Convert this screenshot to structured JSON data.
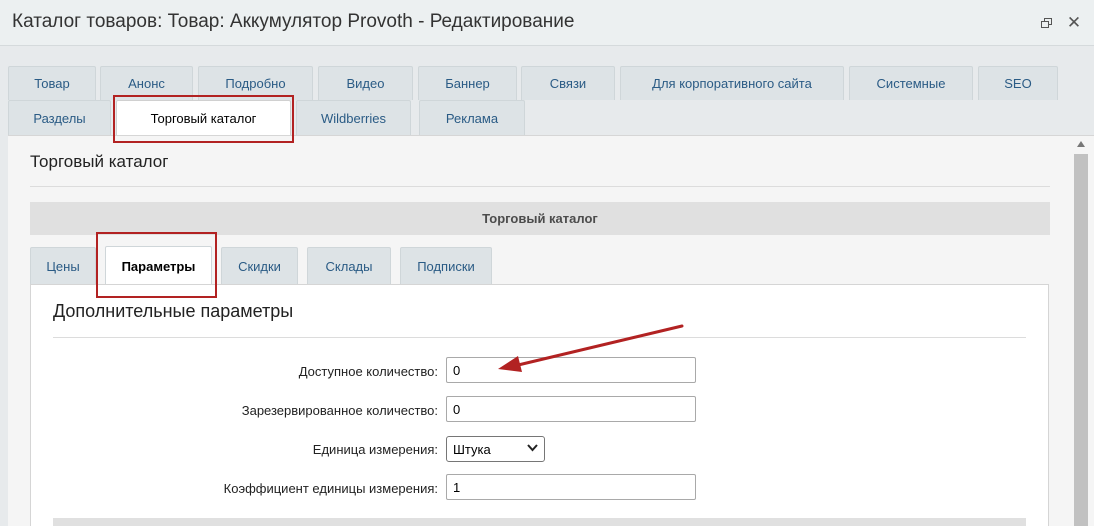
{
  "window": {
    "title": "Каталог товаров: Товар: Аккумулятор Provoth - Редактирование",
    "restore_icon": "restore-icon",
    "close_icon": "close-icon",
    "close_glyph": "✕"
  },
  "main_tabs": [
    {
      "label": "Товар"
    },
    {
      "label": "Анонс"
    },
    {
      "label": "Подробно"
    },
    {
      "label": "Видео"
    },
    {
      "label": "Баннер"
    },
    {
      "label": "Связи"
    },
    {
      "label": "Для корпоративного сайта"
    },
    {
      "label": "Системные"
    },
    {
      "label": "SEO"
    },
    {
      "label": "Разделы"
    },
    {
      "label": "Торговый каталог",
      "active": true
    },
    {
      "label": "Wildberries"
    },
    {
      "label": "Реклама"
    }
  ],
  "panel": {
    "title": "Торговый каталог",
    "section_header": "Торговый каталог"
  },
  "sub_tabs": [
    {
      "label": "Цены"
    },
    {
      "label": "Параметры",
      "active": true
    },
    {
      "label": "Скидки"
    },
    {
      "label": "Склады"
    },
    {
      "label": "Подписки"
    }
  ],
  "params": {
    "title": "Дополнительные параметры",
    "available_qty": {
      "label": "Доступное количество:",
      "value": "0"
    },
    "reserved_qty": {
      "label": "Зарезервированное количество:",
      "value": "0"
    },
    "unit": {
      "label": "Единица измерения:",
      "selected": "Штука"
    },
    "unit_ratio": {
      "label": "Коэффициент единицы измерения:",
      "value": "1"
    }
  },
  "colors": {
    "highlight": "#b22222",
    "tab_link": "#2a5b85"
  }
}
